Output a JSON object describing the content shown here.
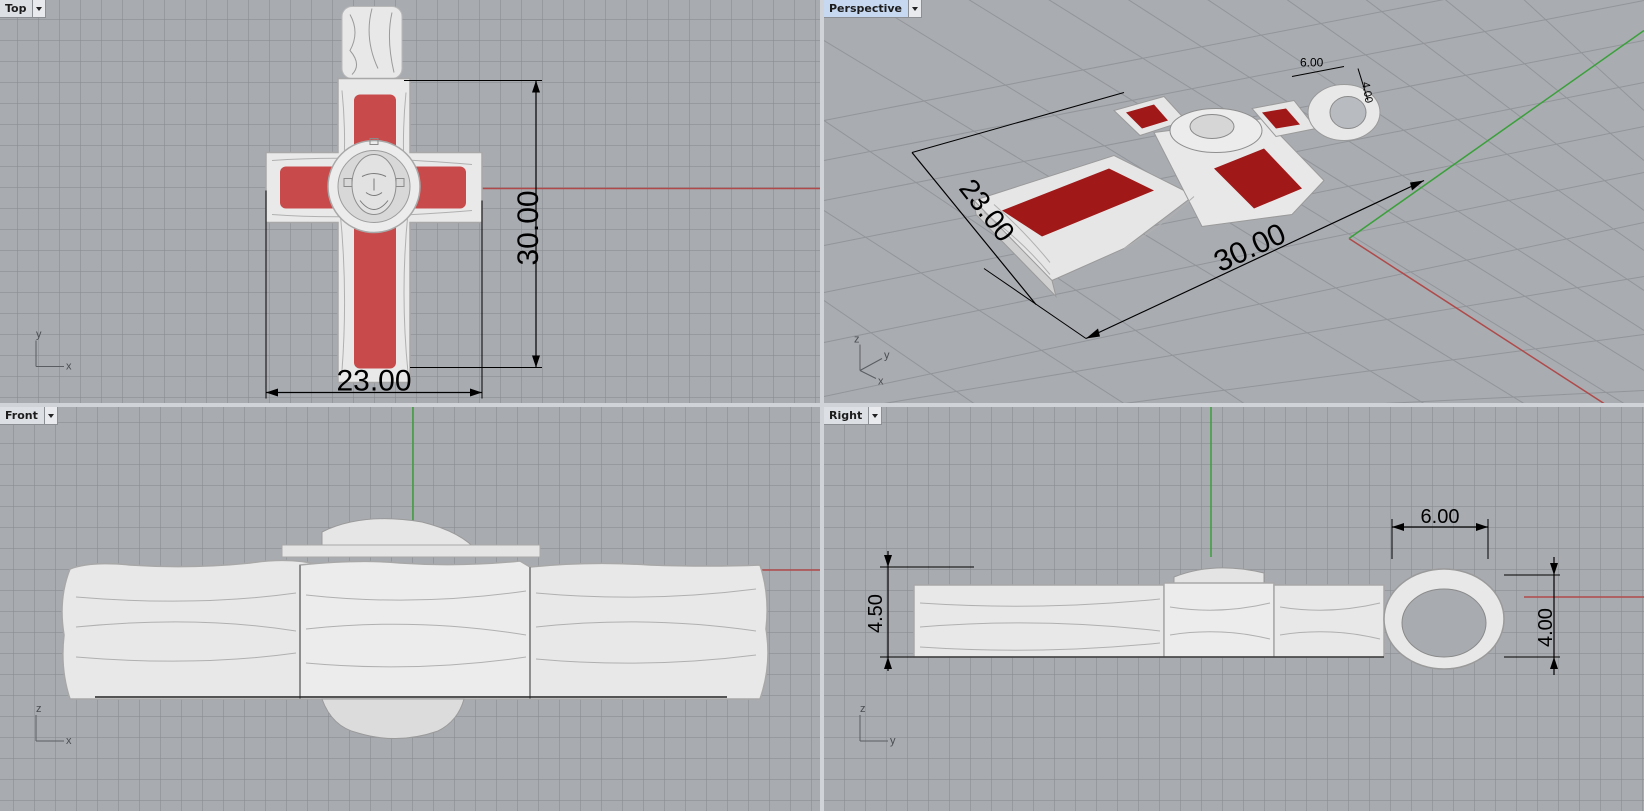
{
  "viewports": {
    "top": {
      "label": "Top"
    },
    "perspective": {
      "label": "Perspective"
    },
    "front": {
      "label": "Front"
    },
    "right": {
      "label": "Right"
    }
  },
  "dimensions": {
    "top_height": "30.00",
    "top_width": "23.00",
    "persp_length": "30.00",
    "persp_width": "23.00",
    "persp_bail_width": "6.00",
    "persp_bail_height": "4.00",
    "right_thickness": "4.50",
    "right_bail_height": "4.00",
    "right_bail_width": "6.00"
  },
  "axis_labels": {
    "x": "x",
    "y": "y",
    "z": "z"
  },
  "colors": {
    "viewport_bg": "#a8abb0",
    "grid_line": "#878a8f",
    "x_axis": "#b04a4a",
    "y_axis": "#3aa03a",
    "enamel": "#c84a4a",
    "metal": "#e6e6e6",
    "active_tab": "#c6d9f0"
  },
  "icons": [
    "dropdown-arrow-icon",
    "axis-triad-icon"
  ]
}
